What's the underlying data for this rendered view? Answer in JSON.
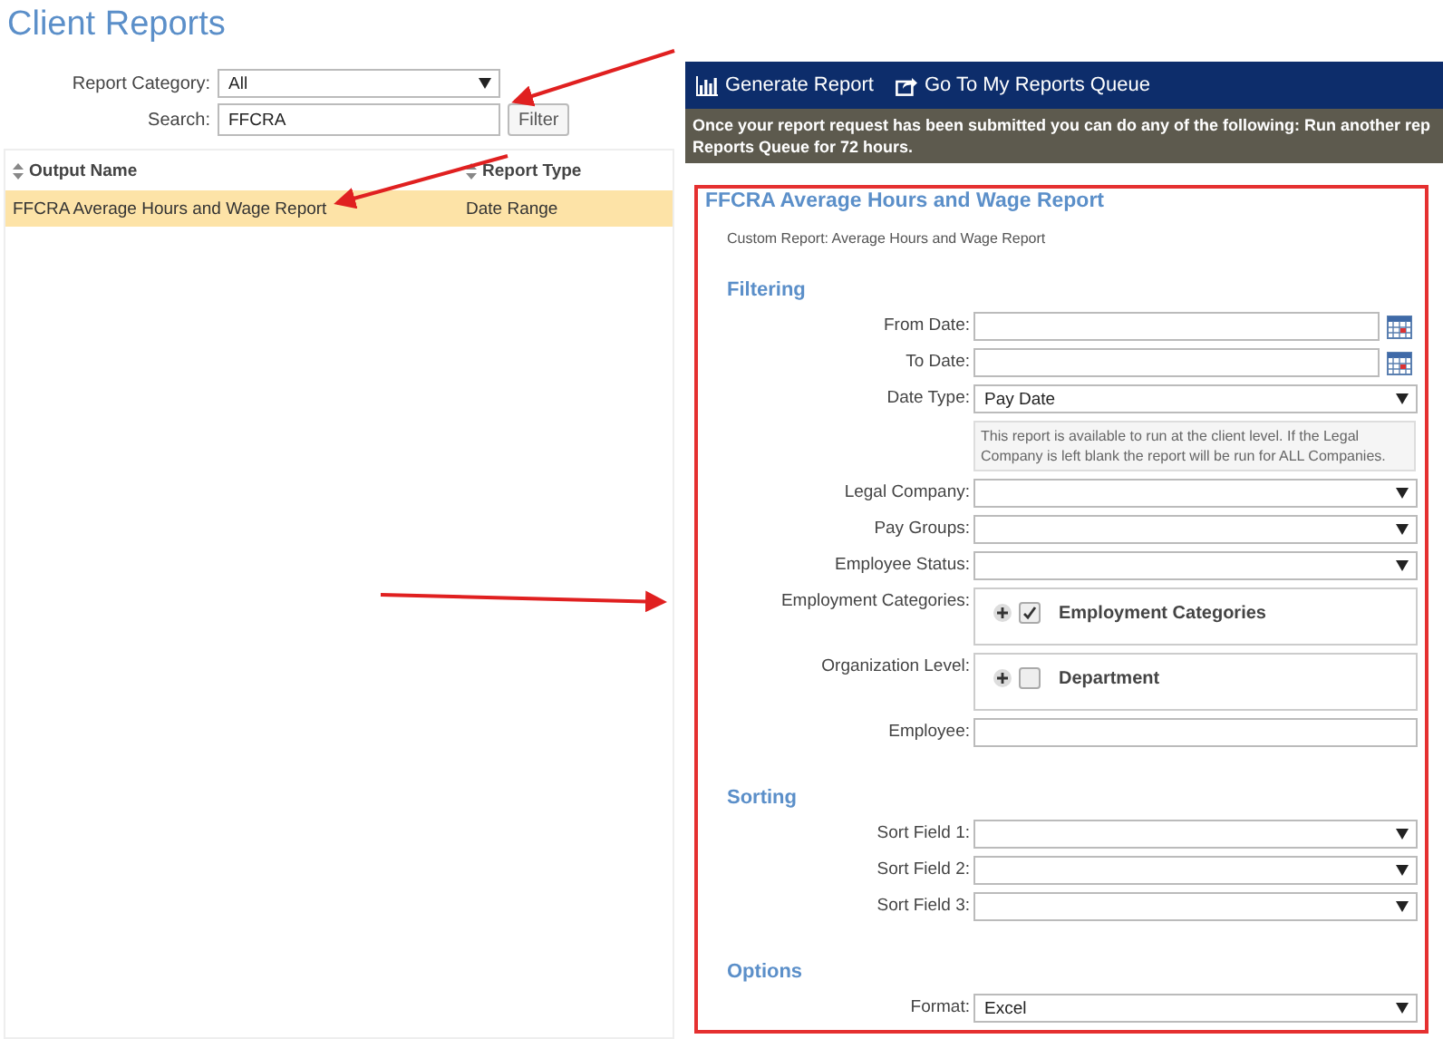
{
  "page_title": "Client Reports",
  "filters": {
    "category_label": "Report Category:",
    "category_value": "All",
    "search_label": "Search:",
    "search_value": "FFCRA",
    "filter_button": "Filter"
  },
  "table": {
    "columns": [
      "Output Name",
      "Report Type"
    ],
    "rows": [
      {
        "cells": [
          "FFCRA Average Hours and Wage Report",
          "Date Range"
        ],
        "selected": true
      }
    ]
  },
  "toolbar": [
    "Generate Report",
    "Go To My Reports Queue"
  ],
  "notice": [
    "Once your report request has been submitted you can do any of the following: Run another rep",
    "Reports Queue for 72 hours."
  ],
  "report": {
    "title": "FFCRA Average Hours and Wage Report",
    "subtitle": "Custom Report: Average Hours and Wage Report",
    "sections": [
      {
        "title": "Filtering",
        "fields": [
          {
            "kind": "date",
            "label": "From Date:"
          },
          {
            "kind": "date",
            "label": "To Date:"
          },
          {
            "kind": "select",
            "label": "Date Type:",
            "value": "Pay Date"
          },
          {
            "kind": "note",
            "text": "This report is available to run at the client level. If the Legal Company is left blank the report will be run for ALL Companies."
          },
          {
            "kind": "select",
            "label": "Legal Company:"
          },
          {
            "kind": "select",
            "label": "Pay Groups:"
          },
          {
            "kind": "select",
            "label": "Employee Status:"
          },
          {
            "kind": "tree",
            "label": "Employment Categories:",
            "item": "Employment Categories",
            "checked": true
          },
          {
            "kind": "tree",
            "label": "Organization Level:",
            "item": "Department",
            "checked": false
          },
          {
            "kind": "text",
            "label": "Employee:"
          }
        ]
      },
      {
        "title": "Sorting",
        "fields": [
          {
            "kind": "select",
            "label": "Sort Field 1:"
          },
          {
            "kind": "select",
            "label": "Sort Field 2:"
          },
          {
            "kind": "select",
            "label": "Sort Field 3:"
          }
        ]
      },
      {
        "title": "Options",
        "fields": [
          {
            "kind": "select",
            "label": "Format:",
            "value": "Excel"
          }
        ]
      }
    ]
  }
}
